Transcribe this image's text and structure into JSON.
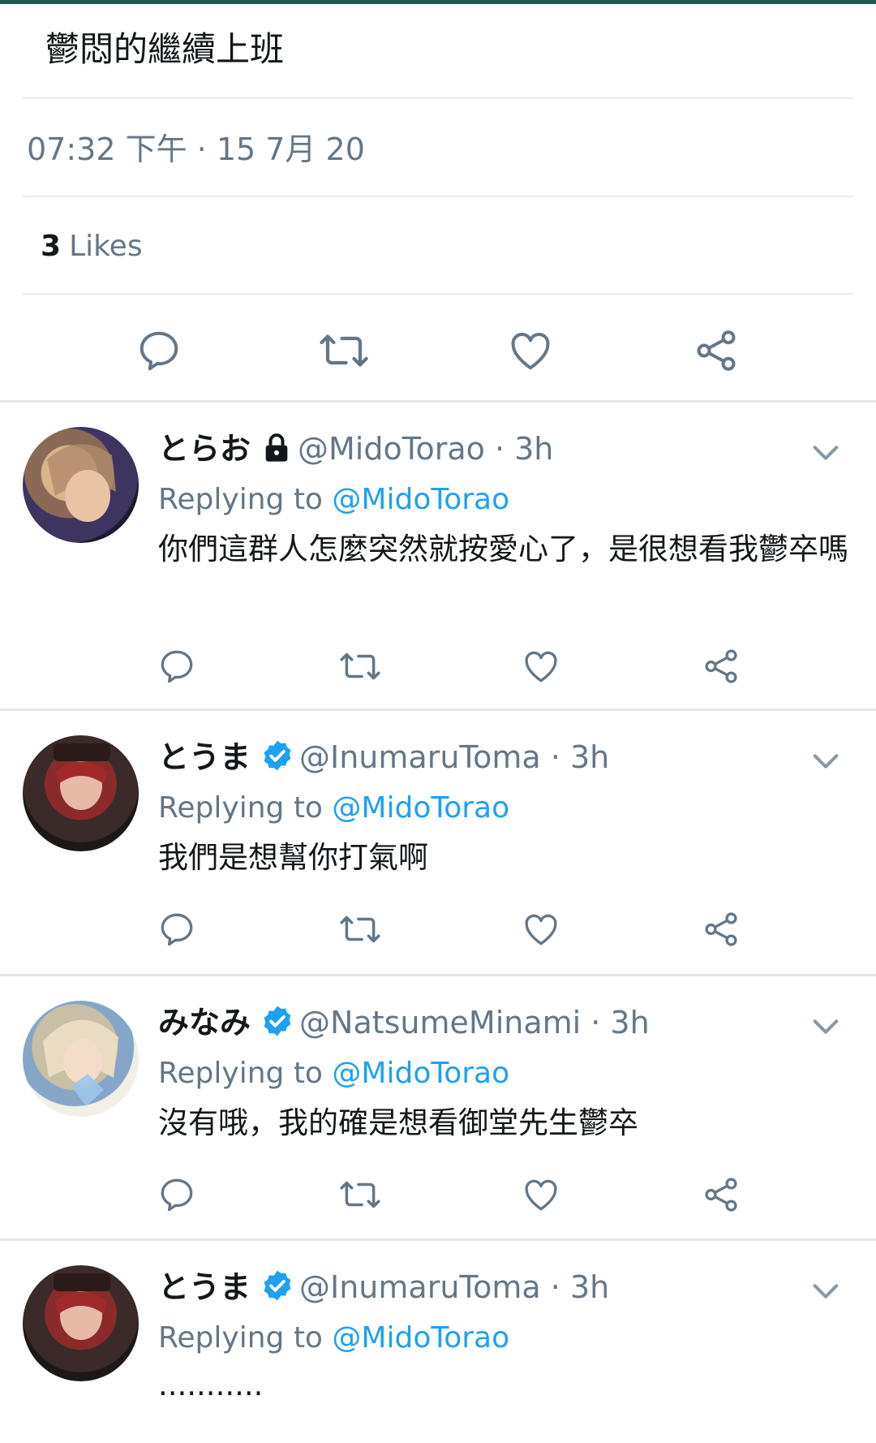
{
  "main_tweet": {
    "text": "鬱悶的繼續上班",
    "timestamp": "07:32 下午 · 15 7月 20",
    "likes_count": "3",
    "likes_label": "Likes",
    "actions": [
      "reply-icon",
      "retweet-icon",
      "like-icon",
      "share-icon"
    ]
  },
  "replies": [
    {
      "display_name": "とらお",
      "badge": "lock-icon",
      "handle_time": "@MidoTorao · 3h",
      "replying_prefix": "Replying to",
      "replying_to": "@MidoTorao",
      "text": "你們這群人怎麼突然就按愛心了，是很想看我鬱卒嗎"
    },
    {
      "display_name": "とうま",
      "badge": "verified-icon",
      "handle_time": "@InumaruToma · 3h",
      "replying_prefix": "Replying to",
      "replying_to": "@MidoTorao",
      "text": "我們是想幫你打氣啊"
    },
    {
      "display_name": "みなみ",
      "badge": "verified-icon",
      "handle_time": "@NatsumeMinami · 3h",
      "replying_prefix": "Replying to",
      "replying_to": "@MidoTorao",
      "text": "沒有哦，我的確是想看御堂先生鬱卒"
    },
    {
      "display_name": "とうま",
      "badge": "verified-icon",
      "handle_time": "@InumaruToma · 3h",
      "replying_prefix": "Replying to",
      "replying_to": "@MidoTorao",
      "text": "..........."
    }
  ],
  "colors": {
    "accent": "#1da1f2",
    "secondary_text": "#657786",
    "primary_text": "#14171a",
    "icon": "#657786",
    "top_bar": "#1c5c4f"
  }
}
